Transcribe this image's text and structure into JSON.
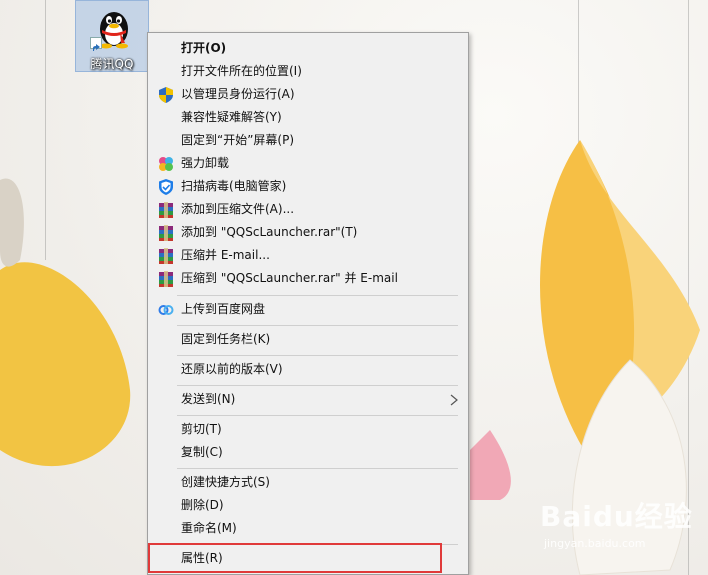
{
  "desktop_icon": {
    "label": "腾讯QQ",
    "icon": "qq-penguin-icon"
  },
  "context_menu": {
    "items": [
      {
        "label": "打开(O)",
        "icon": null,
        "bold": true
      },
      {
        "label": "打开文件所在的位置(I)",
        "icon": null
      },
      {
        "label": "以管理员身份运行(A)",
        "icon": "uac-shield-icon"
      },
      {
        "label": "兼容性疑难解答(Y)",
        "icon": null
      },
      {
        "label": "固定到“开始”屏幕(P)",
        "icon": null
      },
      {
        "label": "强力卸载",
        "icon": "uninstall-clover-icon"
      },
      {
        "label": "扫描病毒(电脑管家)",
        "icon": "pc-manager-shield-icon"
      },
      {
        "label": "添加到压缩文件(A)...",
        "icon": "winrar-icon"
      },
      {
        "label": "添加到 \"QQScLauncher.rar\"(T)",
        "icon": "winrar-icon"
      },
      {
        "label": "压缩并 E-mail...",
        "icon": "winrar-icon"
      },
      {
        "label": "压缩到 \"QQScLauncher.rar\" 并 E-mail",
        "icon": "winrar-icon"
      },
      {
        "label": "上传到百度网盘",
        "icon": "baidu-netdisk-icon"
      },
      {
        "label": "固定到任务栏(K)",
        "icon": null
      },
      {
        "label": "还原以前的版本(V)",
        "icon": null
      },
      {
        "label": "发送到(N)",
        "icon": null,
        "submenu": true
      },
      {
        "label": "剪切(T)",
        "icon": null
      },
      {
        "label": "复制(C)",
        "icon": null
      },
      {
        "label": "创建快捷方式(S)",
        "icon": null
      },
      {
        "label": "删除(D)",
        "icon": null
      },
      {
        "label": "重命名(M)",
        "icon": null
      },
      {
        "label": "属性(R)",
        "icon": null,
        "highlighted": true
      }
    ]
  },
  "watermark": {
    "text": "Baidu经验",
    "url": "jingyan.baidu.com"
  },
  "colors": {
    "highlight_border": "#e03a3a",
    "menu_bg": "#f0f0f0"
  }
}
